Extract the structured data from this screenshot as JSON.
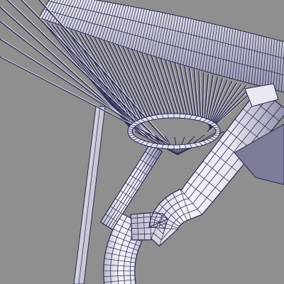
{
  "viewport": {
    "colors": {
      "background": "#8f8f8f",
      "mesh_fill_light": "#f1f1f6",
      "mesh_fill_mid": "#c9c9d8",
      "mesh_fill_shadow": "#8e8ea6",
      "wire": "#2a2c55",
      "highlight": "#ffffff"
    },
    "subject": {
      "description_hidden": true,
      "icon": "wireframe-mesh-icon"
    }
  }
}
